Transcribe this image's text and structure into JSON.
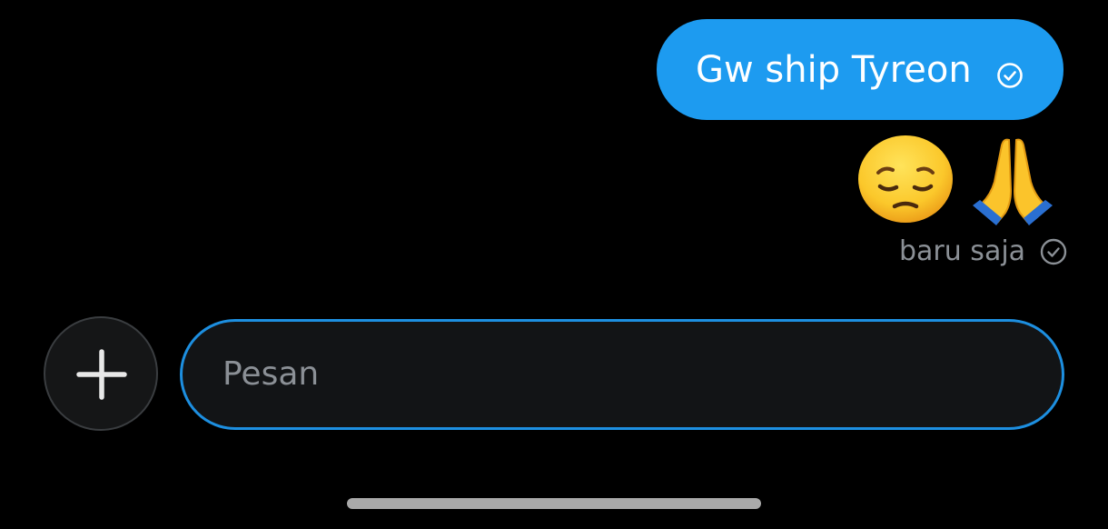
{
  "colors": {
    "background": "#000000",
    "bubble": "#1d9bf0",
    "composer_border": "#1d8fe0",
    "muted_text": "#8b9096"
  },
  "message": {
    "text": "Gw ship Tyreon",
    "status_icon": "check-circle-icon",
    "emojis": [
      "pensive-face-emoji",
      "folded-hands-emoji"
    ]
  },
  "status": {
    "text": "baru saja",
    "icon": "check-circle-icon"
  },
  "composer": {
    "placeholder": "Pesan",
    "add_icon": "plus-icon"
  }
}
